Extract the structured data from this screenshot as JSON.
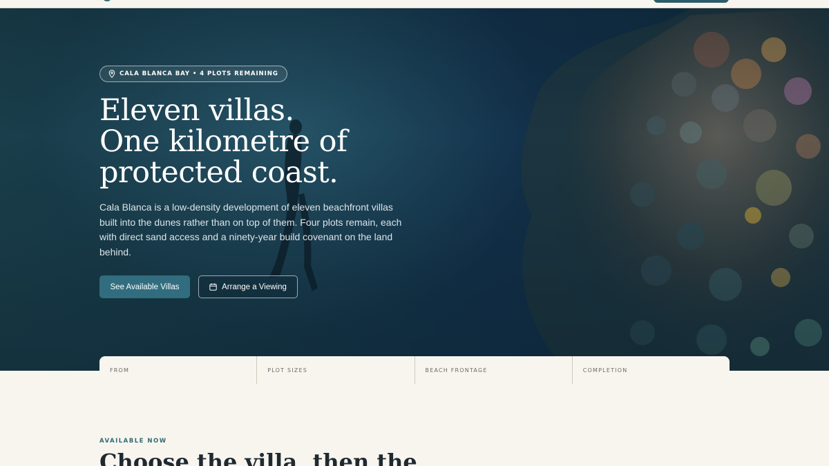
{
  "badge": {
    "icon": "map-pin-icon",
    "text": "CALA BLANCA BAY • 4 PLOTS REMAINING"
  },
  "hero": {
    "headline_lines": [
      "Eleven villas.",
      "One kilometre of",
      "protected coast."
    ],
    "lede": "Cala Blanca is a low-density development of eleven beachfront villas built into the dunes rather than on top of them. Four plots remain, each with direct sand access and a ninety-year build covenant on the land behind.",
    "primary_button": "See Available Villas",
    "secondary_button": "Arrange a Viewing",
    "secondary_icon": "calendar-icon"
  },
  "stats": [
    {
      "label": "FROM"
    },
    {
      "label": "PLOT SIZES"
    },
    {
      "label": "BEACH FRONTAGE"
    },
    {
      "label": "COMPLETION"
    }
  ],
  "section": {
    "eyebrow": "AVAILABLE NOW",
    "title": "Choose the villa, then the"
  },
  "colors": {
    "accent": "#316d7e",
    "background": "#f8f5ef",
    "hero_deep": "#12304a"
  }
}
